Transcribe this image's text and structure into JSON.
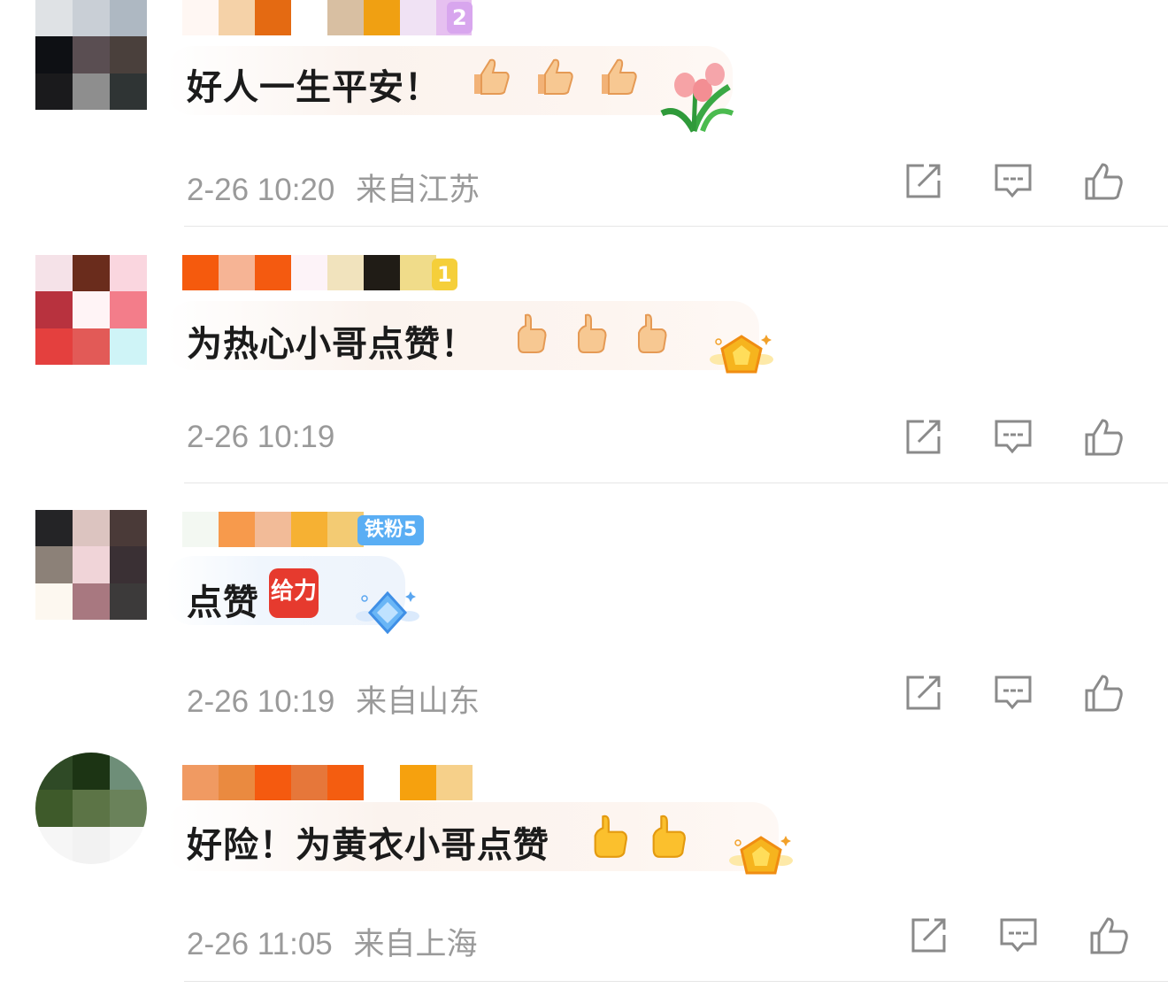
{
  "comments": [
    {
      "text": "好人一生平安！",
      "date": "2-26 10:20",
      "location": "来自江苏",
      "decoration": "tulip-flowers",
      "badge": "2"
    },
    {
      "text": "为热心小哥点赞！",
      "date": "2-26 10:19",
      "location": "",
      "decoration": "gold-medal",
      "badge": "1"
    },
    {
      "text": "点赞",
      "date": "2-26 10:19",
      "location": "来自山东",
      "decoration": "blue-diamond-medal",
      "badge": "铁粉5",
      "sticker": "给力"
    },
    {
      "text": "好险！为黄衣小哥点赞",
      "date": "2-26 11:05",
      "location": "来自上海",
      "decoration": "gold-medal"
    }
  ],
  "icons": {
    "share": "share-edit-icon",
    "reply": "comment-bubble-icon",
    "like": "thumbs-up-icon",
    "emoji": "thumbs-up-emoji"
  },
  "colors": {
    "text": "#1b1b1b",
    "meta": "#9a9a9a",
    "icon": "#8a8a8a",
    "divider": "#e6e6e6"
  }
}
